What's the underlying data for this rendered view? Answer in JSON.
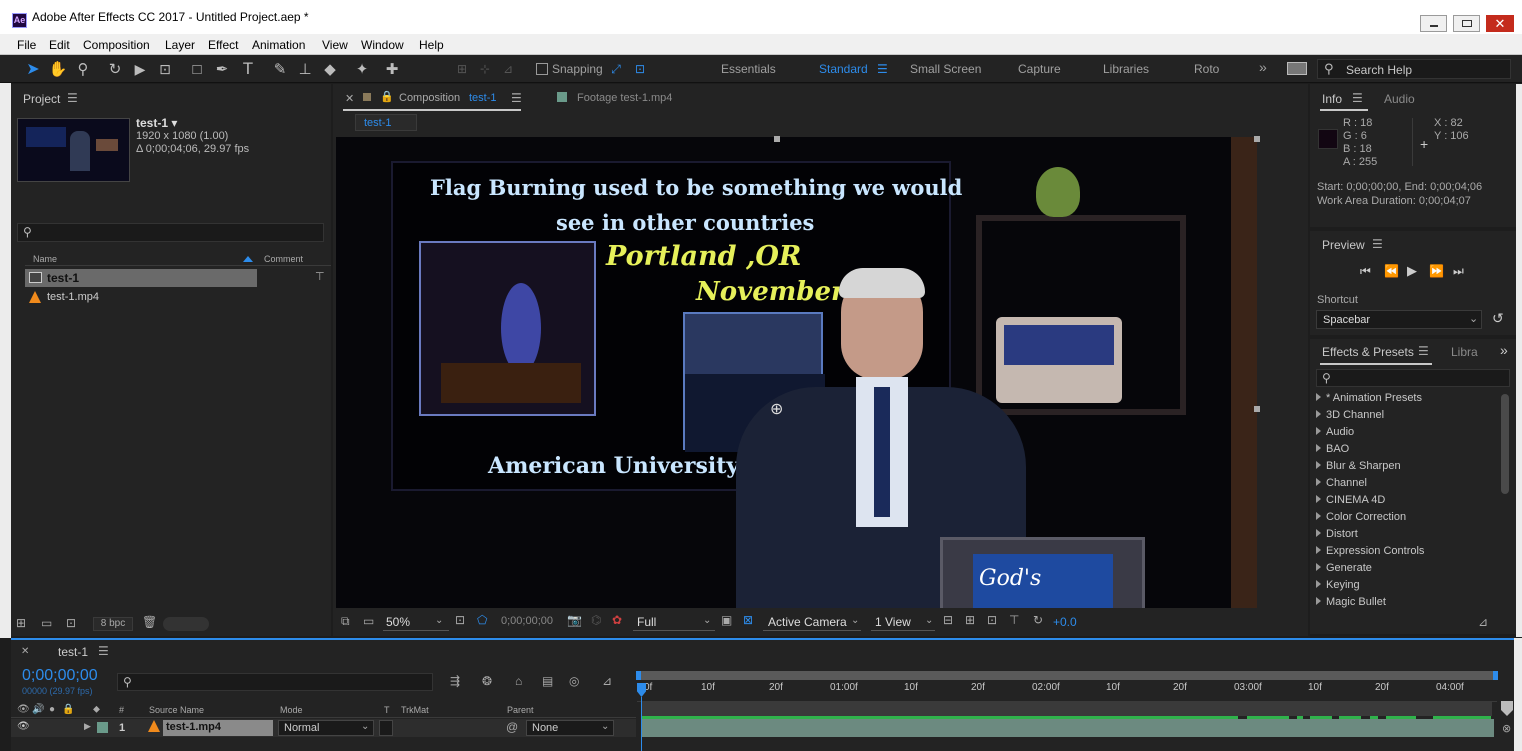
{
  "app": {
    "title": "Adobe After Effects CC 2017 - Untitled Project.aep *",
    "icon": "Ae"
  },
  "menu": [
    "File",
    "Edit",
    "Composition",
    "Layer",
    "Effect",
    "Animation",
    "View",
    "Window",
    "Help"
  ],
  "toolbar": {
    "snapping": "Snapping",
    "workspaces": [
      "Essentials",
      "Standard",
      "Small Screen",
      "Capture",
      "Libraries",
      "Roto"
    ],
    "active_workspace": "Standard",
    "search_placeholder": "Search Help"
  },
  "project": {
    "title": "Project",
    "item_name": "test-1 ▾",
    "resolution": "1920 x 1080 (1.00)",
    "duration": "Δ 0;00;04;06, 29.97 fps",
    "col_name": "Name",
    "col_comment": "Comment",
    "items": [
      {
        "name": "test-1",
        "type": "comp",
        "selected": true
      },
      {
        "name": "test-1.mp4",
        "type": "footage",
        "selected": false
      }
    ],
    "bpc": "8 bpc"
  },
  "viewer": {
    "tab_comp_prefix": "Composition",
    "tab_comp_name": "test-1",
    "tab_footage": "Footage test-1.mp4",
    "breadcrumb": "test-1",
    "zoom": "50%",
    "timecode": "0;00;00;00",
    "resolution": "Full",
    "camera": "Active Camera",
    "views": "1 View",
    "exposure": "+0.0"
  },
  "video": {
    "line1": "Flag Burning used to be something we would",
    "line2": "see in other countries",
    "city": "Portland ,OR",
    "date": "November 9",
    "bottom": "American University W",
    "laptop": "God's"
  },
  "info": {
    "tab_info": "Info",
    "tab_audio": "Audio",
    "r": "R : 18",
    "g": "G : 6",
    "b": "B : 18",
    "a": "A : 255",
    "x": "X : 82",
    "y": "Y : 106",
    "line1": "Start: 0;00;00;00, End: 0;00;04;06",
    "line2": "Work Area Duration: 0;00;04;07",
    "swatch": "#120612"
  },
  "preview": {
    "title": "Preview",
    "shortcut_label": "Shortcut",
    "shortcut_value": "Spacebar"
  },
  "effects": {
    "title": "Effects & Presets",
    "tab2": "Libra",
    "items": [
      "* Animation Presets",
      "3D Channel",
      "Audio",
      "BAO",
      "Blur & Sharpen",
      "Channel",
      "CINEMA 4D",
      "Color Correction",
      "Distort",
      "Expression Controls",
      "Generate",
      "Keying",
      "Magic Bullet"
    ]
  },
  "timeline": {
    "tab": "test-1",
    "timecode": "0;00;00;00",
    "frames": "00000 (29.97 fps)",
    "headers": {
      "num": "#",
      "source": "Source Name",
      "mode": "Mode",
      "t": "T",
      "trkmat": "TrkMat",
      "parent": "Parent"
    },
    "layer": {
      "index": "1",
      "name": "test-1.mp4",
      "mode": "Normal",
      "parent": "None"
    },
    "ruler": [
      "0f",
      "10f",
      "20f",
      "01:00f",
      "10f",
      "20f",
      "02:00f",
      "10f",
      "20f",
      "03:00f",
      "10f",
      "20f",
      "04:00f"
    ]
  },
  "colors": {
    "accent": "#2d8ceb",
    "bg": "#232323",
    "bar": "#2fb34b"
  }
}
